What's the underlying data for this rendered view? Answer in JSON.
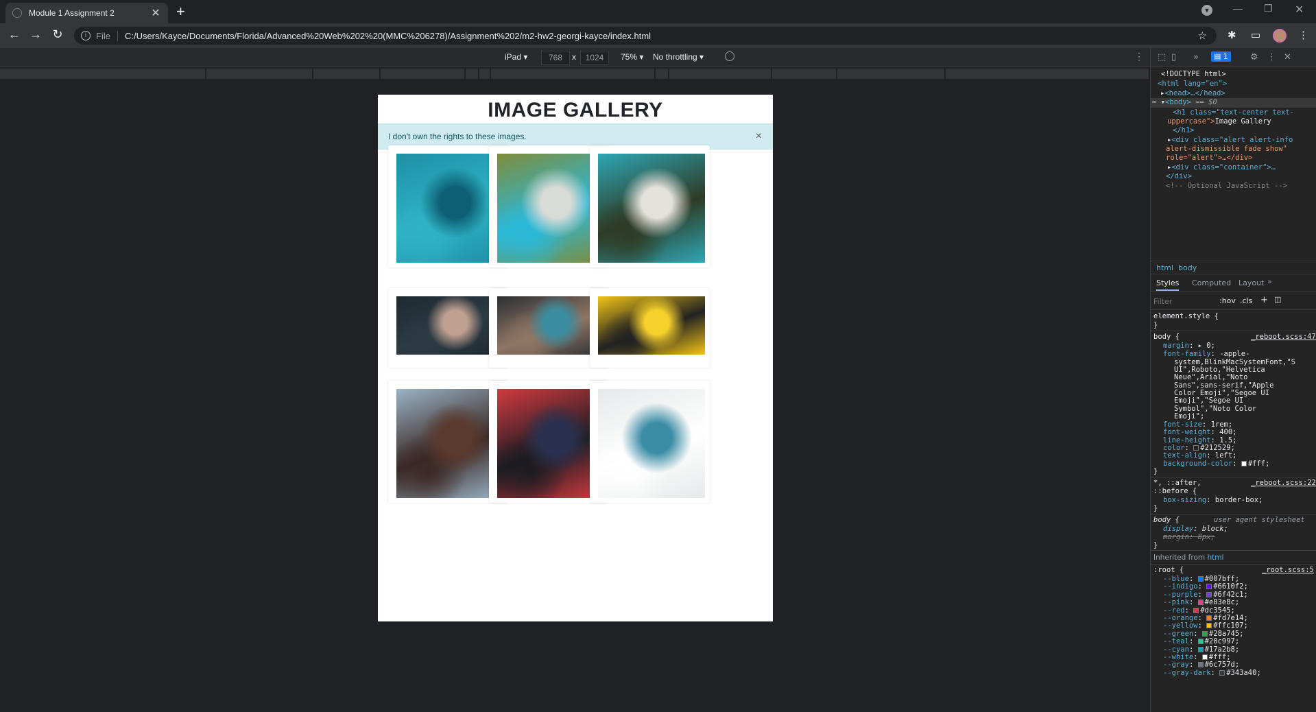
{
  "browser": {
    "tab_title": "Module 1 Assignment 2",
    "new_tab": "+",
    "scheme_label": "File",
    "url": "C:/Users/Kayce/Documents/Florida/Advanced%20Web%202%20(MMC%206278)/Assignment%202/m2-hw2-georgi-kayce/index.html"
  },
  "device_toolbar": {
    "device": "iPad ▾",
    "width": "768",
    "times": "x",
    "height": "1024",
    "zoom": "75% ▾",
    "throttling": "No throttling ▾"
  },
  "page": {
    "title": "IMAGE GALLERY",
    "alert_text": "I don't own the rights to these images.",
    "alert_close": "×"
  },
  "gallery": [
    {
      "name": "aerial-reef",
      "colors": [
        "#1f8fa6",
        "#0d5f73",
        "#2fb3c6"
      ]
    },
    {
      "name": "palm-beach-upside-down",
      "colors": [
        "#7f8c3a",
        "#d9dbd6",
        "#2ab9d8"
      ]
    },
    {
      "name": "aerial-beach-cars",
      "colors": [
        "#2ea7b5",
        "#e5e2dc",
        "#2e3b25"
      ]
    },
    {
      "name": "donuts-sprinkles",
      "colors": [
        "#1f2a30",
        "#c0a090",
        "#2b3a44"
      ]
    },
    {
      "name": "graffiti-girl",
      "colors": [
        "#2b2f33",
        "#3a8da0",
        "#8f7563"
      ]
    },
    {
      "name": "headphones-yellow",
      "colors": [
        "#f2c416",
        "#f7d12b",
        "#222222"
      ]
    },
    {
      "name": "curved-building",
      "colors": [
        "#9ab4c7",
        "#5b3a2e",
        "#3a2824"
      ]
    },
    {
      "name": "boy-graffiti",
      "colors": [
        "#d13a3f",
        "#2a3150",
        "#1c1c22"
      ]
    },
    {
      "name": "buildings-looking-up",
      "colors": [
        "#e6e9ea",
        "#3b8da6",
        "#ffffff"
      ]
    }
  ],
  "devtools": {
    "issues_count": "1",
    "dom": {
      "doctype": "<!DOCTYPE html>",
      "html_open": "<html lang=\"en\">",
      "head": "<head>…</head>",
      "body": "<body>",
      "body_marker": "== $0",
      "h1_open": "<h1 class=\"text-center text-",
      "h1_cont": "uppercase\">",
      "h1_text": "Image Gallery",
      "h1_close": "</h1>",
      "alert_open": "<div class=\"alert alert-info",
      "alert_cont1": "alert-dismissible fade show\"",
      "alert_cont2": "role=\"alert\">…</div>",
      "container_open": "<div class=\"container\">…",
      "container_close": "</div>",
      "comment": "<!-- Optional JavaScript -->"
    },
    "crumbs": [
      "html",
      "body"
    ],
    "tabs": [
      "Styles",
      "Computed",
      "Layout",
      "»"
    ],
    "filter_placeholder": "Filter",
    "hov": ":hov",
    "cls": ".cls",
    "styles": {
      "element_style": "element.style {",
      "close": "}",
      "body_sel": "body {",
      "body_src": "_reboot.scss:47",
      "margin": "margin",
      "margin_val": "▸ 0;",
      "font_family": "font-family",
      "font_family_val": "-apple-",
      "ff_lines": [
        "system,BlinkMacSystemFont,\"S",
        "UI\",Roboto,\"Helvetica",
        "Neue\",Arial,\"Noto",
        "Sans\",sans-serif,\"Apple",
        "Color Emoji\",\"Segoe UI",
        "Emoji\",\"Segoe UI",
        "Symbol\",\"Noto Color",
        "Emoji\";"
      ],
      "font_size": "font-size",
      "font_size_val": "1rem;",
      "font_weight": "font-weight",
      "font_weight_val": "400;",
      "line_height": "line-height",
      "line_height_val": "1.5;",
      "color": "color",
      "color_val": "#212529;",
      "text_align": "text-align",
      "text_align_val": "left;",
      "bg": "background-color",
      "bg_val": "#fff;",
      "star_sel": "*, ::after,",
      "star_sel2": "::before {",
      "star_src": "_reboot.scss:22",
      "box_sizing": "box-sizing",
      "box_sizing_val": "border-box;",
      "ua_sel": "body {",
      "ua_src": "user agent stylesheet",
      "display": "display",
      "display_val": "block;",
      "ua_margin": "margin",
      "ua_margin_val": "8px;",
      "inherited": "Inherited from",
      "inherited_el": "html",
      "root_sel": ":root {",
      "root_src": "_root.scss:5",
      "vars": [
        {
          "name": "--blue",
          "value": "#007bff;",
          "color": "#007bff"
        },
        {
          "name": "--indigo",
          "value": "#6610f2;",
          "color": "#6610f2"
        },
        {
          "name": "--purple",
          "value": "#6f42c1;",
          "color": "#6f42c1"
        },
        {
          "name": "--pink",
          "value": "#e83e8c;",
          "color": "#e83e8c"
        },
        {
          "name": "--red",
          "value": "#dc3545;",
          "color": "#dc3545"
        },
        {
          "name": "--orange",
          "value": "#fd7e14;",
          "color": "#fd7e14"
        },
        {
          "name": "--yellow",
          "value": "#ffc107;",
          "color": "#ffc107"
        },
        {
          "name": "--green",
          "value": "#28a745;",
          "color": "#28a745"
        },
        {
          "name": "--teal",
          "value": "#20c997;",
          "color": "#20c997"
        },
        {
          "name": "--cyan",
          "value": "#17a2b8;",
          "color": "#17a2b8"
        },
        {
          "name": "--white",
          "value": "#fff;",
          "color": "#ffffff"
        },
        {
          "name": "--gray",
          "value": "#6c757d;",
          "color": "#6c757d"
        },
        {
          "name": "--gray-dark",
          "value": "#343a40;",
          "color": "#343a40"
        }
      ]
    }
  }
}
